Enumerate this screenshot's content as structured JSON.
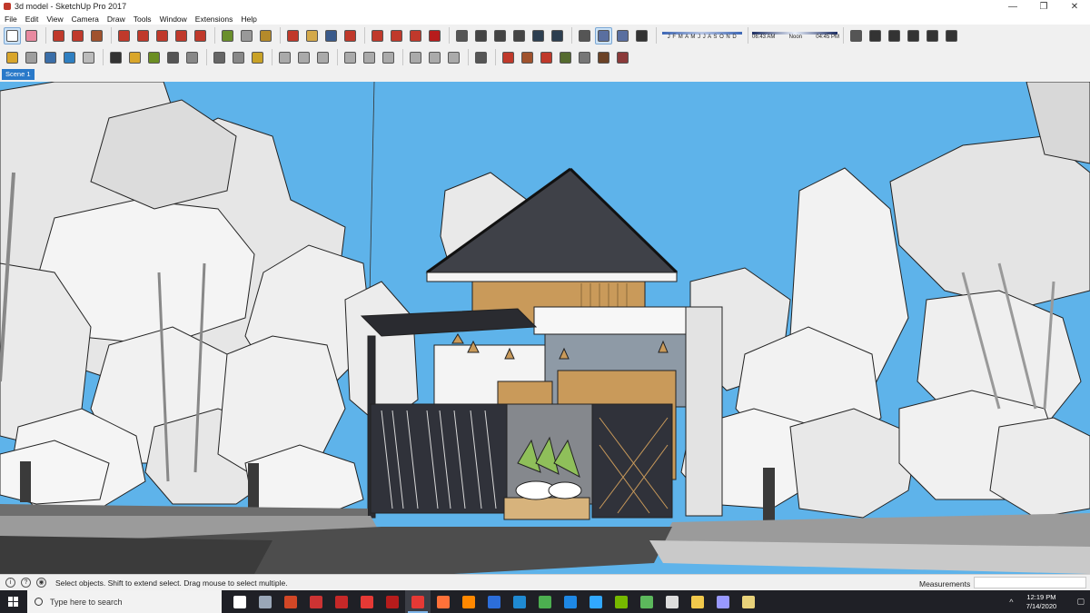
{
  "window": {
    "title": "3d model - SketchUp Pro 2017",
    "minimize_glyph": "—",
    "restore_glyph": "❐",
    "close_glyph": "✕"
  },
  "menu": [
    "File",
    "Edit",
    "View",
    "Camera",
    "Draw",
    "Tools",
    "Window",
    "Extensions",
    "Help"
  ],
  "toolbar": {
    "shadow_months": "J F M A M J J A S O N D",
    "time_start": "06:43 AM",
    "time_mid": "Noon",
    "time_end": "04:45 PM",
    "row1_icons": [
      {
        "name": "select-arrow-icon",
        "color": "#ffffff",
        "selected": true
      },
      {
        "name": "eraser-icon",
        "color": "#e88aa0"
      },
      {
        "name": "line-pencil-icon",
        "color": "#c0392b"
      },
      {
        "name": "arc-icon",
        "color": "#c0392b"
      },
      {
        "name": "rectangle-icon",
        "color": "#a0522d"
      },
      {
        "name": "push-pull-icon",
        "color": "#c0392b"
      },
      {
        "name": "follow-me-icon",
        "color": "#c0392b"
      },
      {
        "name": "move-icon",
        "color": "#c0392b"
      },
      {
        "name": "rotate-icon",
        "color": "#c0392b"
      },
      {
        "name": "scale-icon",
        "color": "#c0392b"
      },
      {
        "name": "tape-measure-icon",
        "color": "#6a8f2b"
      },
      {
        "name": "text-icon",
        "color": "#999999"
      },
      {
        "name": "paint-bucket-icon",
        "color": "#b58a2a"
      },
      {
        "name": "orbit-icon",
        "color": "#c0392b"
      },
      {
        "name": "pan-icon",
        "color": "#d4a94a"
      },
      {
        "name": "zoom-icon",
        "color": "#3a5a8a"
      },
      {
        "name": "zoom-extents-icon",
        "color": "#c0392b"
      },
      {
        "name": "warehouse-icon",
        "color": "#c0392b"
      },
      {
        "name": "share-model-icon",
        "color": "#c0392b"
      },
      {
        "name": "extension-warehouse-icon",
        "color": "#c0392b"
      },
      {
        "name": "ruby-icon",
        "color": "#b71c1c"
      },
      {
        "name": "section-plane-icon",
        "color": "#555555"
      },
      {
        "name": "xray-icon",
        "color": "#444444"
      },
      {
        "name": "wireframe-icon",
        "color": "#444444"
      },
      {
        "name": "hidden-line-icon",
        "color": "#444444"
      },
      {
        "name": "shaded-icon",
        "color": "#2c3e50"
      },
      {
        "name": "textured-icon",
        "color": "#2c3e50"
      },
      {
        "name": "camera-position-icon",
        "color": "#555555"
      },
      {
        "name": "perspective-icon",
        "color": "#5a6fa0",
        "selected": true
      },
      {
        "name": "two-point-icon",
        "color": "#5a6fa0"
      },
      {
        "name": "shadow-toggle-icon",
        "color": "#333333"
      }
    ],
    "row1_right_icons": [
      {
        "name": "iso-view-icon",
        "color": "#555555"
      },
      {
        "name": "top-view-icon",
        "color": "#333333"
      },
      {
        "name": "front-view-icon",
        "color": "#333333"
      },
      {
        "name": "right-view-icon",
        "color": "#333333"
      },
      {
        "name": "back-view-icon",
        "color": "#333333"
      },
      {
        "name": "left-view-icon",
        "color": "#333333"
      }
    ],
    "row2_icons": [
      {
        "name": "solid-tools-icon",
        "color": "#d9a62b"
      },
      {
        "name": "sandbox-icon",
        "color": "#9e9e9e"
      },
      {
        "name": "large-tool-set-icon",
        "color": "#3a6ea8"
      },
      {
        "name": "warehouse-upload-icon",
        "color": "#2f7fc1"
      },
      {
        "name": "layer-icon",
        "color": "#bbbbbb"
      },
      {
        "name": "styles-icon",
        "color": "#333333"
      },
      {
        "name": "outer-shell-icon",
        "color": "#d9a62b"
      },
      {
        "name": "trim-icon",
        "color": "#6b8e23"
      },
      {
        "name": "dynamic-component-icon",
        "color": "#555555"
      },
      {
        "name": "sound-icon",
        "color": "#888888"
      },
      {
        "name": "components-icon",
        "color": "#666666"
      },
      {
        "name": "add-location-icon",
        "color": "#888888"
      },
      {
        "name": "photo-texture-icon",
        "color": "#c9a227"
      },
      {
        "name": "standard-views-a-icon",
        "color": "#aaaaaa"
      },
      {
        "name": "standard-views-b-icon",
        "color": "#aaaaaa"
      },
      {
        "name": "standard-views-c-icon",
        "color": "#aaaaaa"
      },
      {
        "name": "sandbox-smoove-icon",
        "color": "#aaaaaa"
      },
      {
        "name": "sandbox-stamp-icon",
        "color": "#aaaaaa"
      },
      {
        "name": "sandbox-drape-icon",
        "color": "#aaaaaa"
      },
      {
        "name": "sandbox-detail-icon",
        "color": "#aaaaaa"
      },
      {
        "name": "sandbox-flip-icon",
        "color": "#aaaaaa"
      },
      {
        "name": "sandbox-grid-icon",
        "color": "#aaaaaa"
      },
      {
        "name": "geo-location-icon",
        "color": "#555555"
      },
      {
        "name": "material-a-icon",
        "color": "#c0392b"
      },
      {
        "name": "material-b-icon",
        "color": "#a0522d"
      },
      {
        "name": "render-a-icon",
        "color": "#c0392b"
      },
      {
        "name": "render-b-icon",
        "color": "#556b2f"
      },
      {
        "name": "render-c-icon",
        "color": "#777777"
      },
      {
        "name": "render-d-icon",
        "color": "#6b4226"
      },
      {
        "name": "render-e-icon",
        "color": "#8b3a3a"
      }
    ]
  },
  "scenes": {
    "active_tab": "Scene 1"
  },
  "status": {
    "message": "Select objects. Shift to extend select. Drag mouse to select multiple.",
    "measurements_label": "Measurements",
    "measurements_value": "",
    "icon_info": "i",
    "icon_help": "?",
    "icon_user": "◉"
  },
  "taskbar": {
    "search_placeholder": "Type here to search",
    "time": "12:19 PM",
    "date": "7/14/2020",
    "tray_arrow": "^",
    "tray_notif": "▢",
    "apps": [
      {
        "name": "task-view-icon",
        "color": "#ffffff"
      },
      {
        "name": "camera-app-icon",
        "color": "#9aa7b8"
      },
      {
        "name": "powerpoint-icon",
        "color": "#d24726"
      },
      {
        "name": "media-player-icon",
        "color": "#cc3333"
      },
      {
        "name": "pdf-reader-icon",
        "color": "#c62828"
      },
      {
        "name": "acrobat-icon",
        "color": "#e53935"
      },
      {
        "name": "red-app-icon",
        "color": "#b71c1c"
      },
      {
        "name": "sketchup-icon",
        "color": "#e53935",
        "active": true
      },
      {
        "name": "firefox-icon",
        "color": "#ff7139"
      },
      {
        "name": "vlc-icon",
        "color": "#ff8800"
      },
      {
        "name": "malwarebytes-icon",
        "color": "#2c6eda"
      },
      {
        "name": "edge-icon",
        "color": "#1f8ad2"
      },
      {
        "name": "chrome-icon",
        "color": "#4caf50"
      },
      {
        "name": "mail-icon",
        "color": "#1e88e5"
      },
      {
        "name": "photoshop-icon",
        "color": "#31a8ff"
      },
      {
        "name": "nvidia-icon",
        "color": "#76b900"
      },
      {
        "name": "camtasia-icon",
        "color": "#5cb85c"
      },
      {
        "name": "store-icon",
        "color": "#dddddd"
      },
      {
        "name": "explorer-icon",
        "color": "#f2c94c"
      },
      {
        "name": "premiere-icon",
        "color": "#9999ff"
      },
      {
        "name": "movie-maker-icon",
        "color": "#e8d27a"
      }
    ]
  },
  "colors": {
    "sky": "#5eb3ea",
    "foliage": "#e9e9e9",
    "roof": "#3f4148",
    "wood": "#c99a5a",
    "asphalt": "#4d4d4d",
    "sidewalk": "#9b9b9b"
  }
}
